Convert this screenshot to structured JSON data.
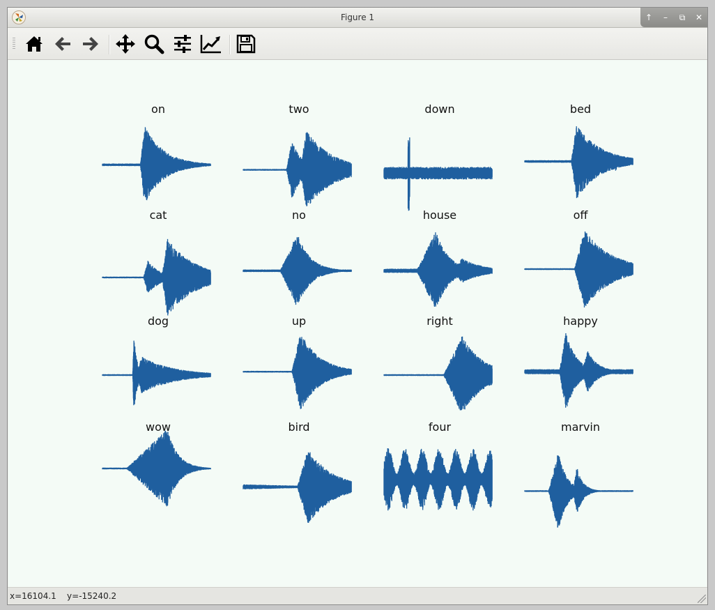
{
  "window": {
    "title": "Figure 1"
  },
  "toolbar": {
    "tools": [
      {
        "icon": "home-icon"
      },
      {
        "icon": "back-icon"
      },
      {
        "icon": "forward-icon"
      },
      {
        "icon": "pan-icon"
      },
      {
        "icon": "zoom-icon"
      },
      {
        "icon": "configure-subplots-icon"
      },
      {
        "icon": "edit-axis-icon"
      },
      {
        "icon": "save-icon"
      }
    ]
  },
  "status": {
    "coords": "x=16104.1    y=-15240.2"
  },
  "colors": {
    "waveform": "#1f5f9f",
    "canvas": "#f4fbf6"
  },
  "chart_data": {
    "type": "line",
    "subplots": [
      {
        "title": "on"
      },
      {
        "title": "two"
      },
      {
        "title": "down"
      },
      {
        "title": "bed"
      },
      {
        "title": "cat"
      },
      {
        "title": "no"
      },
      {
        "title": "house"
      },
      {
        "title": "off"
      },
      {
        "title": "dog"
      },
      {
        "title": "up"
      },
      {
        "title": "right"
      },
      {
        "title": "happy"
      },
      {
        "title": "wow"
      },
      {
        "title": "bird"
      },
      {
        "title": "four"
      },
      {
        "title": "marvin"
      }
    ]
  }
}
